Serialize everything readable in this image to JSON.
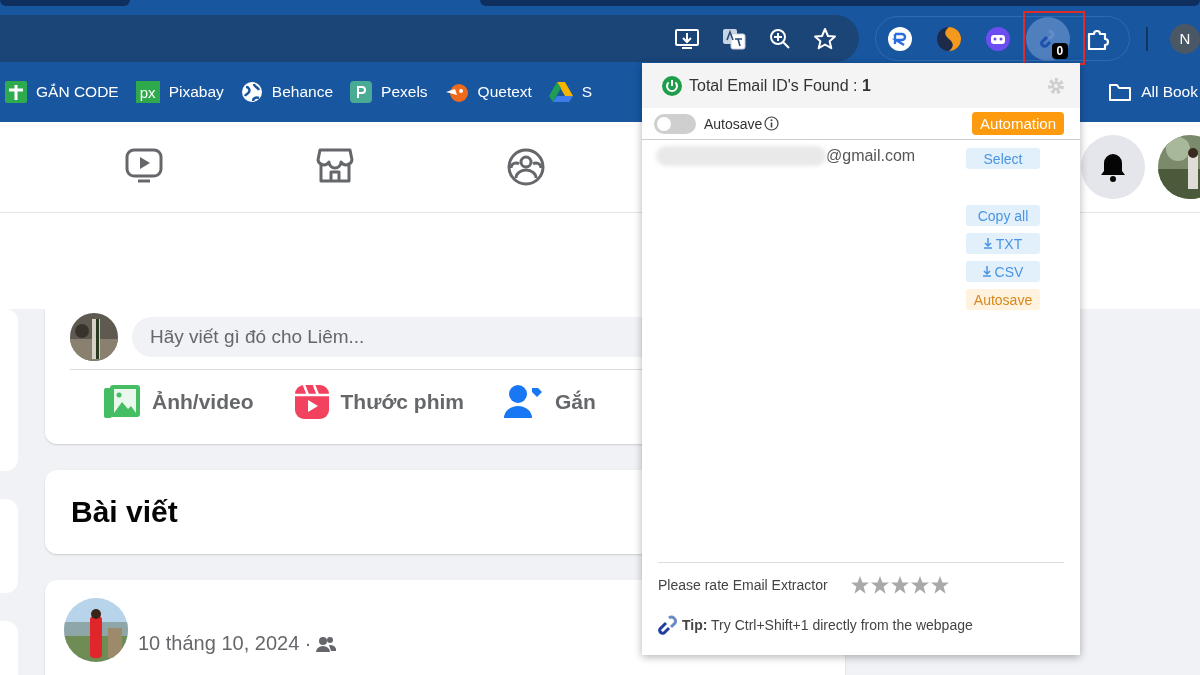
{
  "toolbar": {
    "extension_badge": "0",
    "profile_initial": "N"
  },
  "bookmarks": [
    {
      "label": "GẮN CODE"
    },
    {
      "label": "Pixabay",
      "icon_text": "px"
    },
    {
      "label": "Behance"
    },
    {
      "label": "Pexels"
    },
    {
      "label": "Quetext"
    },
    {
      "label": "S"
    }
  ],
  "all_bookmarks": "All Book",
  "composer": {
    "placeholder": "Hãy viết gì đó cho Liêm...",
    "actions": [
      "Ảnh/video",
      "Thước phim",
      "Gắn"
    ]
  },
  "posts_header": {
    "title": "Bài viết"
  },
  "post": {
    "date": "10 tháng 10, 2024 ·"
  },
  "extension_popup": {
    "title": "Total Email ID's Found : ",
    "count": "1",
    "autosave_toggle": {
      "label": "Autosave",
      "on": false
    },
    "automation_button": "Automation",
    "emails": [
      {
        "suffix": "@gmail.com"
      }
    ],
    "buttons": [
      {
        "label": "Select",
        "kind": "plain",
        "disabled": true
      },
      {
        "label": "Copy all",
        "kind": "plain",
        "disabled": true
      },
      {
        "label": "TXT",
        "kind": "download",
        "disabled": true
      },
      {
        "label": "CSV",
        "kind": "download",
        "disabled": true
      },
      {
        "label": "Autosave",
        "kind": "orange",
        "disabled": true
      }
    ],
    "rating": {
      "label": "Please rate Email Extractor",
      "stars": 0
    },
    "tip": "**Tip:** Try Ctrl+Shift+1 directly from the webpage"
  }
}
